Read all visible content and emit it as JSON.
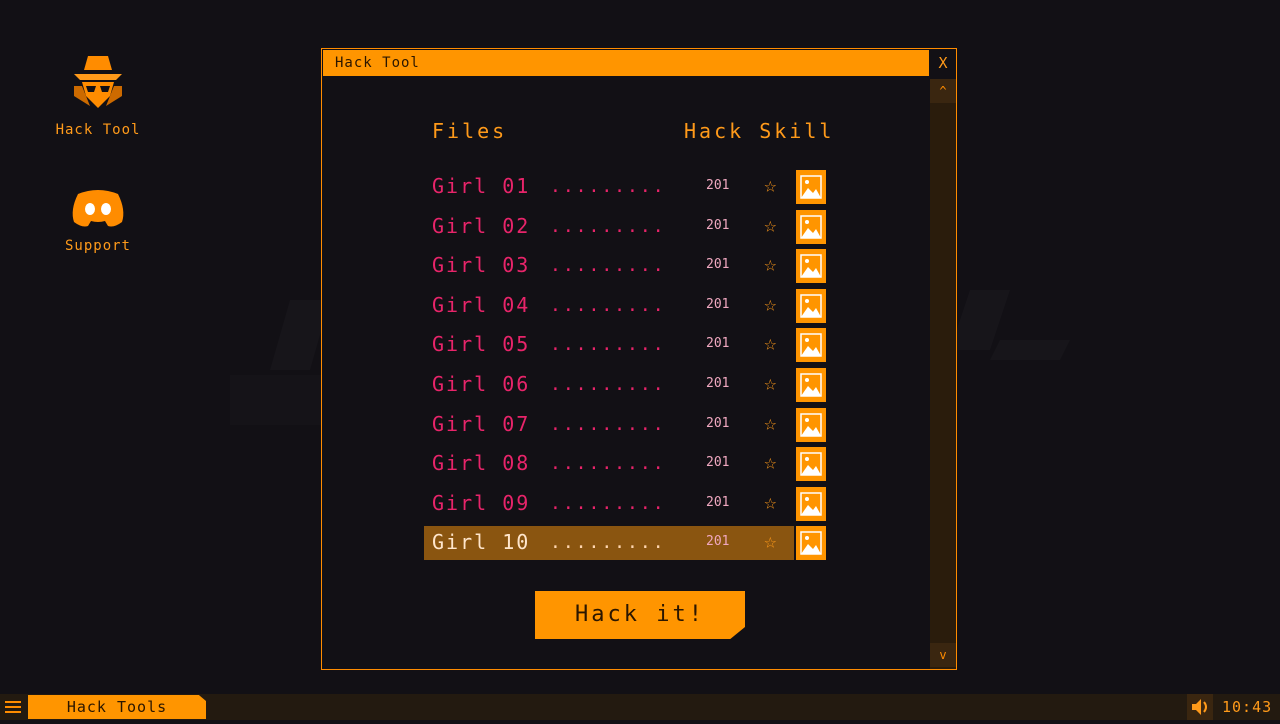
{
  "desktop": {
    "icons": [
      {
        "label": "Hack Tool"
      },
      {
        "label": "Support"
      }
    ]
  },
  "window": {
    "title": "Hack Tool",
    "close_label": "X",
    "scroll_up": "^",
    "scroll_down": "v",
    "columns": {
      "files": "Files",
      "skill": "Hack Skill"
    },
    "rows": [
      {
        "name": "Girl 01",
        "dots": ".........",
        "skill": "201"
      },
      {
        "name": "Girl 02",
        "dots": ".........",
        "skill": "201"
      },
      {
        "name": "Girl 03",
        "dots": ".........",
        "skill": "201"
      },
      {
        "name": "Girl 04",
        "dots": ".........",
        "skill": "201"
      },
      {
        "name": "Girl 05",
        "dots": ".........",
        "skill": "201"
      },
      {
        "name": "Girl 06",
        "dots": ".........",
        "skill": "201"
      },
      {
        "name": "Girl 07",
        "dots": ".........",
        "skill": "201"
      },
      {
        "name": "Girl 08",
        "dots": ".........",
        "skill": "201"
      },
      {
        "name": "Girl 09",
        "dots": ".........",
        "skill": "201"
      },
      {
        "name": "Girl 10",
        "dots": ".........",
        "skill": "201"
      }
    ],
    "selected_row": 10,
    "hack_button": "Hack it!"
  },
  "taskbar": {
    "task_label": "Hack Tools",
    "clock": "10:43"
  },
  "colors": {
    "accent": "#ff9500",
    "file_name": "#e8246a",
    "background": "#121015",
    "selection": "#8a5510"
  }
}
